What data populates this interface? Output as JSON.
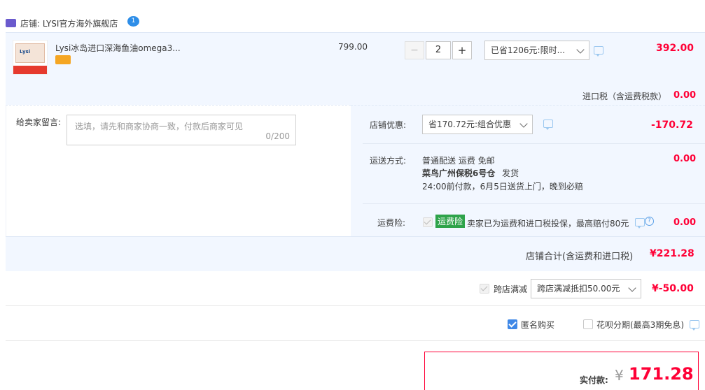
{
  "shop": {
    "label": "店铺: LYSI官方海外旗舰店",
    "badge_text": "1"
  },
  "item": {
    "title": "Lysi冰岛进口深海鱼油omega3...",
    "unit_price": "799.00",
    "quantity": "2",
    "qty_minus": "−",
    "qty_plus": "+",
    "promo_select": "已省1206元:限时...",
    "subtotal": "392.00",
    "image_brand": "Lysi"
  },
  "import_tax": {
    "label": "进口税（含运费税款）",
    "value": "0.00"
  },
  "message": {
    "label": "给卖家留言:",
    "placeholder": "选填，请先和商家协商一致，付款后商家可见",
    "counter": "0/200"
  },
  "shop_discount": {
    "label": "店铺优惠:",
    "select": "省170.72元:组合优惠",
    "value": "-170.72"
  },
  "shipping": {
    "label": "运送方式:",
    "line1": "普通配送 运费 免邮",
    "line2_bold": "菜鸟广州保税6号仓",
    "line2_rest": "发货",
    "line3": "24:00前付款，6月5日送货上门，晚到必赔",
    "value": "0.00"
  },
  "insurance": {
    "label": "运费险:",
    "tag": "运费险",
    "text": "卖家已为运费和进口税投保，最高赔付80元",
    "help": "?",
    "value": "0.00"
  },
  "shop_total": {
    "label": "店铺合计(含运费和进口税)",
    "value": "¥221.28"
  },
  "cross_store": {
    "label": "跨店满减",
    "select": "跨店满减抵扣50.00元",
    "value": "¥-50.00"
  },
  "options": {
    "anonymous": "匿名购买",
    "huabei": "花呗分期(最高3期免息)"
  },
  "payment": {
    "label": "实付款:",
    "currency": "¥",
    "value": "171.28"
  },
  "colors": {
    "accent_red": "#ff0036",
    "light_blue_bg": "#f2f7ff",
    "insurance_green": "#2ea34a",
    "checkbox_blue": "#3f88e7"
  }
}
